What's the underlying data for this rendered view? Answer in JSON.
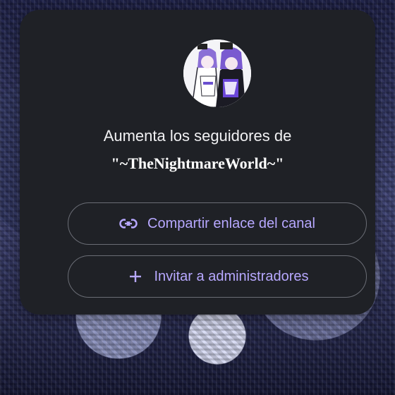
{
  "dialog": {
    "title": "Aumenta los seguidores de",
    "channel_name": "\"~TheNightmareWorld~\"",
    "share_button": {
      "label": "Compartir enlace del canal",
      "icon": "link-icon"
    },
    "invite_button": {
      "label": "Invitar a administradores",
      "icon": "plus-icon"
    },
    "avatar": {
      "icon": "channel-avatar"
    }
  },
  "colors": {
    "card_bg": "#1f2126",
    "accent": "#b7a8ff",
    "text": "#f1f1f3",
    "border": "#6a6d75"
  }
}
